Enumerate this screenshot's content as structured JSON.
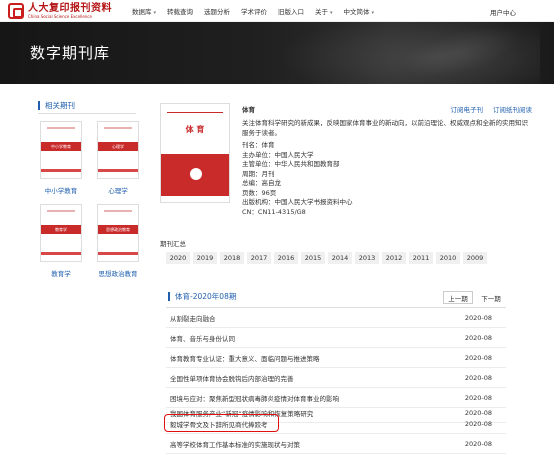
{
  "header": {
    "logo_cn": "人大复印报刊资料",
    "logo_en": "China Social Science Excellence",
    "nav": [
      {
        "label": "数据库",
        "has_caret": true
      },
      {
        "label": "转载查询",
        "has_caret": false
      },
      {
        "label": "选题分析",
        "has_caret": false
      },
      {
        "label": "学术评价",
        "has_caret": false
      },
      {
        "label": "旧版入口",
        "has_caret": false
      },
      {
        "label": "关于",
        "has_caret": true
      },
      {
        "label": "中文简体",
        "has_caret": true
      }
    ],
    "user_center": "用户中心"
  },
  "banner": {
    "title": "数字期刊库"
  },
  "sidebar": {
    "title": "相关期刊",
    "items": [
      {
        "label": "中小学教育",
        "cover_text": "中小学教育"
      },
      {
        "label": "心理学",
        "cover_text": "心理学"
      },
      {
        "label": "教育学",
        "cover_text": "教育学"
      },
      {
        "label": "思想政治教育",
        "cover_text": "思想政治教育"
      }
    ]
  },
  "journal": {
    "cover_title": "体 育",
    "name": "体育",
    "links": [
      "订阅电子刊",
      "订阅纸刊阅读"
    ],
    "description": "关注体育科学研究的新成果，反映国家体育事业的新动向，以前沿理论、权威观点和全新的实用知识服务于读者。",
    "details": [
      "刊名：体育",
      "主办单位：中国人民大学",
      "主管单位：中华人民共和国教育部",
      "周期：月刊",
      "总编：高自龙",
      "页数：96页",
      "出版机构：中国人民大学书报资料中心",
      "CN：CN11-4315/G8"
    ]
  },
  "issues": {
    "section_label": "期刊汇总",
    "years": [
      "2020",
      "2019",
      "2018",
      "2017",
      "2016",
      "2015",
      "2014",
      "2013",
      "2012",
      "2011",
      "2010",
      "2009"
    ],
    "heading": "体育-2020年08期",
    "prev_label": "上一期",
    "next_label": "下一期",
    "articles": [
      {
        "title": "从割裂走向融合",
        "date": "2020-08"
      },
      {
        "title": "体育、音乐与身份认同",
        "date": "2020-08"
      },
      {
        "title": "体育教育专业认证：重大意义、面临问题与推进策略",
        "date": "2020-08"
      },
      {
        "title": "全国性单项体育协会脱钩后内部治理的完善",
        "date": "2020-08"
      },
      {
        "title": "困境与应对：聚焦新型冠状病毒肺炎疫情对体育事业的影响",
        "date": "2020-08"
      },
      {
        "title": "我国体育服务产业“新冠”疫情影响和恢复策略研究",
        "date": "2020-08"
      },
      {
        "title": "毅城学骨文及卜辞所见商代捧跤考",
        "date": "2020-08"
      },
      {
        "title": "高等学校体育工作基本标准的实施现状与对策",
        "date": "2020-08"
      }
    ]
  },
  "colors": {
    "brand_red": "#c81e1e",
    "link_blue": "#1f5fae",
    "highlight_red": "#e01010"
  }
}
